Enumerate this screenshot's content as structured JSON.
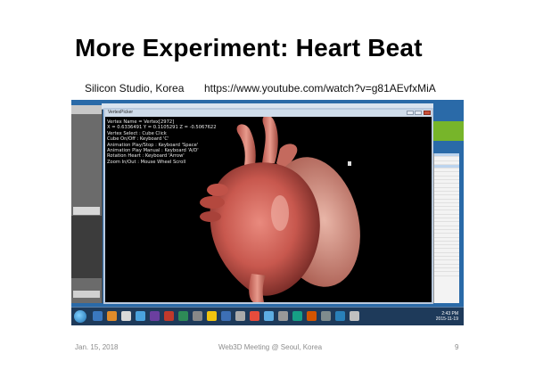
{
  "slide": {
    "title": "More Experiment: Heart Beat",
    "source": "Silicon Studio, Korea",
    "url": "https://www.youtube.com/watch?v=g81AEvfxMiA"
  },
  "viewer": {
    "window_title": "VertexPicker",
    "info_lines": [
      "Vertex Name = Vertex[2972]",
      "X = 0.6336491 Y = 0.1105291 Z = -0.5067622",
      "Vertex Select : Cube Click",
      "Cube On/Off : Keyboard 'C'",
      "Animation Play/Stop : Keyboard 'Space'",
      "Animation Play Manual : Keyboard 'A/D'",
      "Rotation Heart : Keyboard 'Arrow'",
      "Zoom In/Out : Mouse Wheel Scroll"
    ]
  },
  "taskbar": {
    "time": "2:43 PM",
    "date": "2015-11-19"
  },
  "footer": {
    "date": "Jan. 15, 2018",
    "event": "Web3D Meeting @ Seoul, Korea",
    "page": "9"
  },
  "colors": {
    "accent_green": "#77b52a",
    "desktop_blue": "#2a6aa8",
    "heart_red": "#c8584e"
  }
}
